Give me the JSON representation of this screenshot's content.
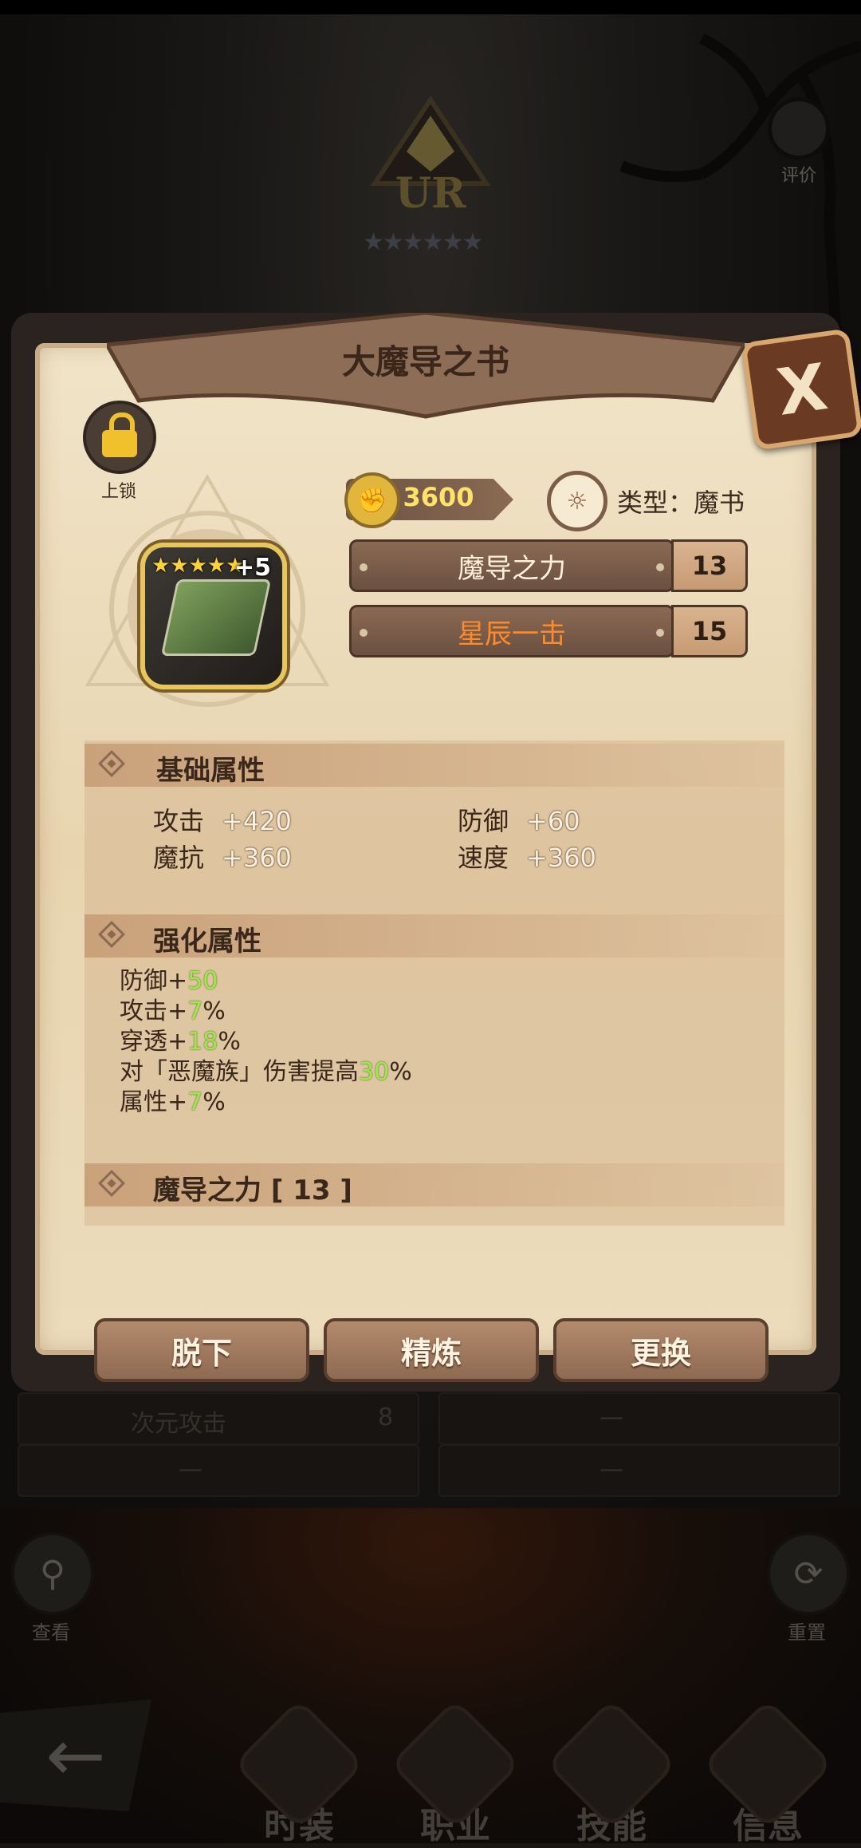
{
  "header": {
    "rarity": "UR",
    "rate_label": "评价"
  },
  "background_list": {
    "rows": [
      {
        "name": "次元攻击",
        "level": "8"
      },
      {
        "name": "",
        "level": "—"
      },
      {
        "name": "—",
        "level": ""
      },
      {
        "name": "",
        "level": "—"
      }
    ]
  },
  "modal": {
    "title": "大魔导之书",
    "close_label": "X",
    "lock_label": "上锁",
    "item": {
      "plus": "+5",
      "stars": 5
    },
    "power": "3600",
    "type_text": "类型：魔书",
    "skills": [
      {
        "name": "魔导之力",
        "level": "13",
        "color": "#fff1dc"
      },
      {
        "name": "星辰一击",
        "level": "15",
        "color": "#ff8a2a"
      }
    ],
    "base_section": {
      "title": "基础属性",
      "attrs": [
        {
          "name": "攻击",
          "value": "+420"
        },
        {
          "name": "防御",
          "value": "+60"
        },
        {
          "name": "魔抗",
          "value": "+360"
        },
        {
          "name": "速度",
          "value": "+360"
        }
      ]
    },
    "enhance_section": {
      "title": "强化属性",
      "lines": [
        {
          "pre": "防御+",
          "num": "50",
          "post": ""
        },
        {
          "pre": "攻击+",
          "num": "7",
          "post": "%"
        },
        {
          "pre": "穿透+",
          "num": "18",
          "post": "%"
        },
        {
          "pre": "对「恶魔族」伤害提高",
          "num": "30",
          "post": "%"
        },
        {
          "pre": "属性+",
          "num": "7",
          "post": "%"
        }
      ]
    },
    "skill_section": {
      "title": "魔导之力 [ 13 ]"
    },
    "buttons": {
      "unequip": "脱下",
      "refine": "精炼",
      "replace": "更换"
    }
  },
  "side_buttons": {
    "view": "查看",
    "reset": "重置"
  },
  "nav": {
    "items": [
      "时装",
      "职业",
      "技能",
      "信息"
    ]
  }
}
